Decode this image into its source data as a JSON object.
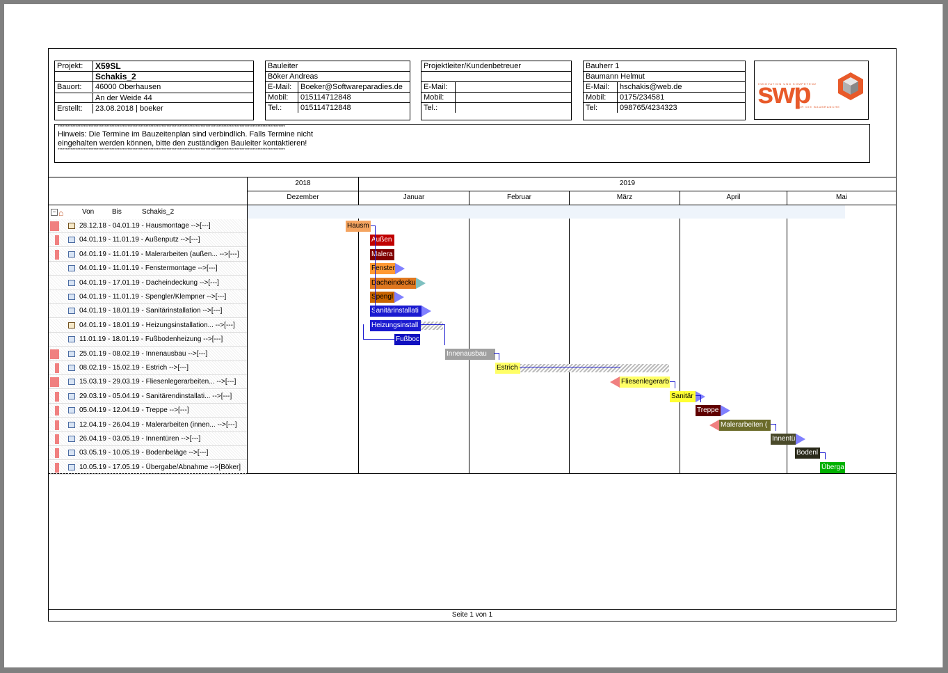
{
  "project": {
    "label_projekt": "Projekt:",
    "name": "X59SL",
    "subname": "Schakis_2",
    "label_bauort": "Bauort:",
    "bauort_1": "46000 Oberhausen",
    "bauort_2": "An der Weide 44",
    "label_erstellt": "Erstellt:",
    "erstellt": "23.08.2018 | boeker"
  },
  "bauleiter": {
    "title": "Bauleiter",
    "name": "Böker Andreas",
    "label_email": "E-Mail:",
    "email": "Boeker@Softwareparadies.de",
    "label_mobil": "Mobil:",
    "mobil": "015114712848",
    "label_tel": "Tel.:",
    "tel": "015114712848"
  },
  "projektleiter": {
    "title": "Projektleiter/Kundenbetreuer",
    "label_email": "E-Mail:",
    "label_mobil": "Mobil:",
    "label_tel": "Tel.:"
  },
  "bauherr": {
    "title": "Bauherr 1",
    "name": "Baumann Helmut",
    "label_email": "E-Mail:",
    "email": "hschakis@web.de",
    "label_mobil": "Mobil:",
    "mobil": "0175/234581",
    "label_tel": "Tel:",
    "tel": "098765/4234323"
  },
  "logo": {
    "tagline": "INNOVATION UND KOMPETENZ",
    "word": "swp",
    "subline": "FÜR DIE BAUBRANCHE"
  },
  "hint": {
    "stars": "********************************************************************************************************************************************",
    "line1": "Hinweis: Die Termine im Bauzeitenplan sind verbindlich. Falls Termine nicht",
    "line2": "eingehalten werden können, bitte den zuständigen Bauleiter kontaktieren!"
  },
  "timeline": {
    "years": [
      "2018",
      "2019"
    ],
    "months": [
      "Dezember",
      "Januar",
      "Februar",
      "März",
      "April",
      "Mai"
    ],
    "col_von": "Von",
    "col_bis": "Bis",
    "col_name": "Schakis_2"
  },
  "tasks": [
    {
      "label": "28.12.18 - 04.01.19 - Hausmontage  -->[---]",
      "bar": "Hausm",
      "color": "#f4a460",
      "crit": true
    },
    {
      "label": "04.01.19 - 11.01.19 - Außenputz  -->[---]",
      "bar": "Außen",
      "color": "#c00000",
      "crit": true
    },
    {
      "label": "04.01.19 - 11.01.19 - Malerarbeiten (außen...  -->[---]",
      "bar": "Malera",
      "color": "#800000",
      "crit": true
    },
    {
      "label": "04.01.19 - 11.01.19 - Fenstermontage  -->[---]",
      "bar": "Fenster",
      "color": "#ff9933",
      "crit": false
    },
    {
      "label": "04.01.19 - 17.01.19 - Dacheindeckung  -->[---]",
      "bar": "Dacheindecku",
      "color": "#e07820",
      "crit": false
    },
    {
      "label": "04.01.19 - 11.01.19 - Spengler/Klempner  -->[---]",
      "bar": "Spengl",
      "color": "#c86400",
      "crit": false
    },
    {
      "label": "04.01.19 - 18.01.19 - Sanitärinstallation  -->[---]",
      "bar": "Sanitärinstallati",
      "color": "#1a1ad0",
      "crit": false
    },
    {
      "label": "04.01.19 - 18.01.19 - Heizungsinstallation...  -->[---]",
      "bar": "Heizungsinstall",
      "color": "#1a1ad0",
      "crit": false
    },
    {
      "label": "11.01.19 - 18.01.19 - Fußbodenheizung  -->[---]",
      "bar": "Fußboc",
      "color": "#1010c0",
      "crit": false
    },
    {
      "label": "25.01.19 - 08.02.19 - Innenausbau  -->[---]",
      "bar": "Innenausbau",
      "color": "#a0a0a0",
      "crit": true
    },
    {
      "label": "08.02.19 - 15.02.19 - Estrich  -->[---]",
      "bar": "Estrich",
      "color": "#ffff66",
      "crit": true
    },
    {
      "label": "15.03.19 - 29.03.19 - Fliesenlegerarbeiten...  -->[---]",
      "bar": "Fliesenlegerarb",
      "color": "#ffff66",
      "crit": true
    },
    {
      "label": "29.03.19 - 05.04.19 - Sanitärendinstallati...  -->[---]",
      "bar": "Sanitär",
      "color": "#ffff33",
      "crit": true
    },
    {
      "label": "05.04.19 - 12.04.19 - Treppe  -->[---]",
      "bar": "Treppe",
      "color": "#600000",
      "crit": true
    },
    {
      "label": "12.04.19 - 26.04.19 - Malerarbeiten (innen...  -->[---]",
      "bar": "Malerarbeiten (",
      "color": "#6b6b2a",
      "crit": true
    },
    {
      "label": "26.04.19 - 03.05.19 - Innentüren  -->[---]",
      "bar": "Innentü",
      "color": "#4a4a2a",
      "crit": true
    },
    {
      "label": "03.05.19 - 10.05.19 - Bodenbeläge  -->[---]",
      "bar": "Bodenl",
      "color": "#2a2a1a",
      "crit": true
    },
    {
      "label": "10.05.19 - 17.05.19 - Übergabe/Abnahme  -->[Böker]",
      "bar": "Überga",
      "color": "#00b000",
      "crit": true
    }
  ],
  "footer": {
    "page": "Seite 1 von 1"
  }
}
